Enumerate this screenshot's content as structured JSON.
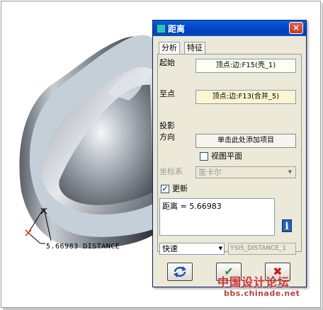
{
  "dialog": {
    "title": "距离",
    "close_glyph": "×",
    "tabs": [
      {
        "label": "分析",
        "active": true
      },
      {
        "label": "特征",
        "active": false
      }
    ],
    "from_label": "起始",
    "from_value": "顶点:边:F15(壳_1)",
    "to_label": "至点",
    "to_value": "顶点:边:F13(合并_5)",
    "projection_label_line1": "投影",
    "projection_label_line2": "方向",
    "projection_button": "单击此处添加项目",
    "view_plane_label": "视图平面",
    "view_plane_checked": false,
    "csys_label": "坐标系",
    "csys_value": "笛卡尔",
    "update_label": "更新",
    "update_checked": true,
    "result_text": "距离 = 5.66983",
    "mode_value": "快速",
    "name_value": "YSIS_DISTANCE_1",
    "buttons": {
      "repeat_icon": "repeat-icon",
      "ok_icon": "checkmark-icon",
      "cancel_icon": "x-icon"
    }
  },
  "viewport": {
    "dimension_text": "5.66983  DISTANCE"
  },
  "watermark": {
    "site_name": "中国设计论坛",
    "url": "bbs.chinade.net"
  },
  "colors": {
    "titlebar": "#0046c8",
    "dialog_bg": "#ece9d8",
    "part_face": "#c5cfd8",
    "ok_green": "#2a9a2a",
    "cancel_red": "#cc1a1a",
    "watermark_red": "#c02020"
  }
}
